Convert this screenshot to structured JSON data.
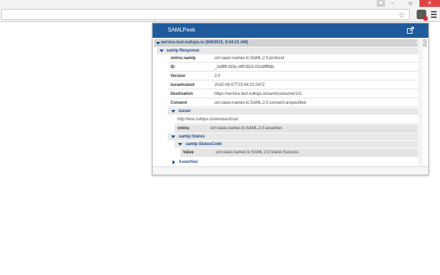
{
  "popup": {
    "title": "SAMLPeek",
    "request": {
      "label": "service.test.nullops.io (9/8/2015, 9:04:21 AM)",
      "tools": "⧉ ✕"
    },
    "response": {
      "label": "samlp:Response",
      "rows": [
        {
          "key": "xmlns:samlp",
          "value": "urn:oasis:names:tc:SAML:2.0:protocol"
        },
        {
          "key": "ID",
          "value": "_2efffff-093c-4fff-f833-01b3fffffdb"
        },
        {
          "key": "Version",
          "value": "2.0"
        },
        {
          "key": "IssueInstant",
          "value": "2015-09-07T23:04:22.047Z"
        },
        {
          "key": "Destination",
          "value": "https://service.test.nullops.io/saml/consume/101"
        },
        {
          "key": "Consent",
          "value": "urn:oasis:names:tc:SAML:2.0:consent:unspecified"
        }
      ]
    },
    "issuer": {
      "label": "Issuer",
      "text": "http://test.nullops.io/services/trust",
      "xmlns_key": "xmlns",
      "xmlns_value": "urn:oasis:names:tc:SAML:2.0:assertion"
    },
    "status": {
      "label": "samlp:Status",
      "code_label": "samlp:StatusCode",
      "value_key": "Value",
      "value": "urn:oasis:names:tc:SAML:2.0:status:Success"
    },
    "assertion": {
      "label": "Assertion"
    }
  },
  "icons": {
    "star": "star-icon",
    "extension": "samlpeek-extension-icon",
    "menu": "menu-icon",
    "popout": "popout-icon"
  },
  "window_controls": {
    "minimize": "–",
    "maximize": "▫",
    "close": "✕"
  }
}
